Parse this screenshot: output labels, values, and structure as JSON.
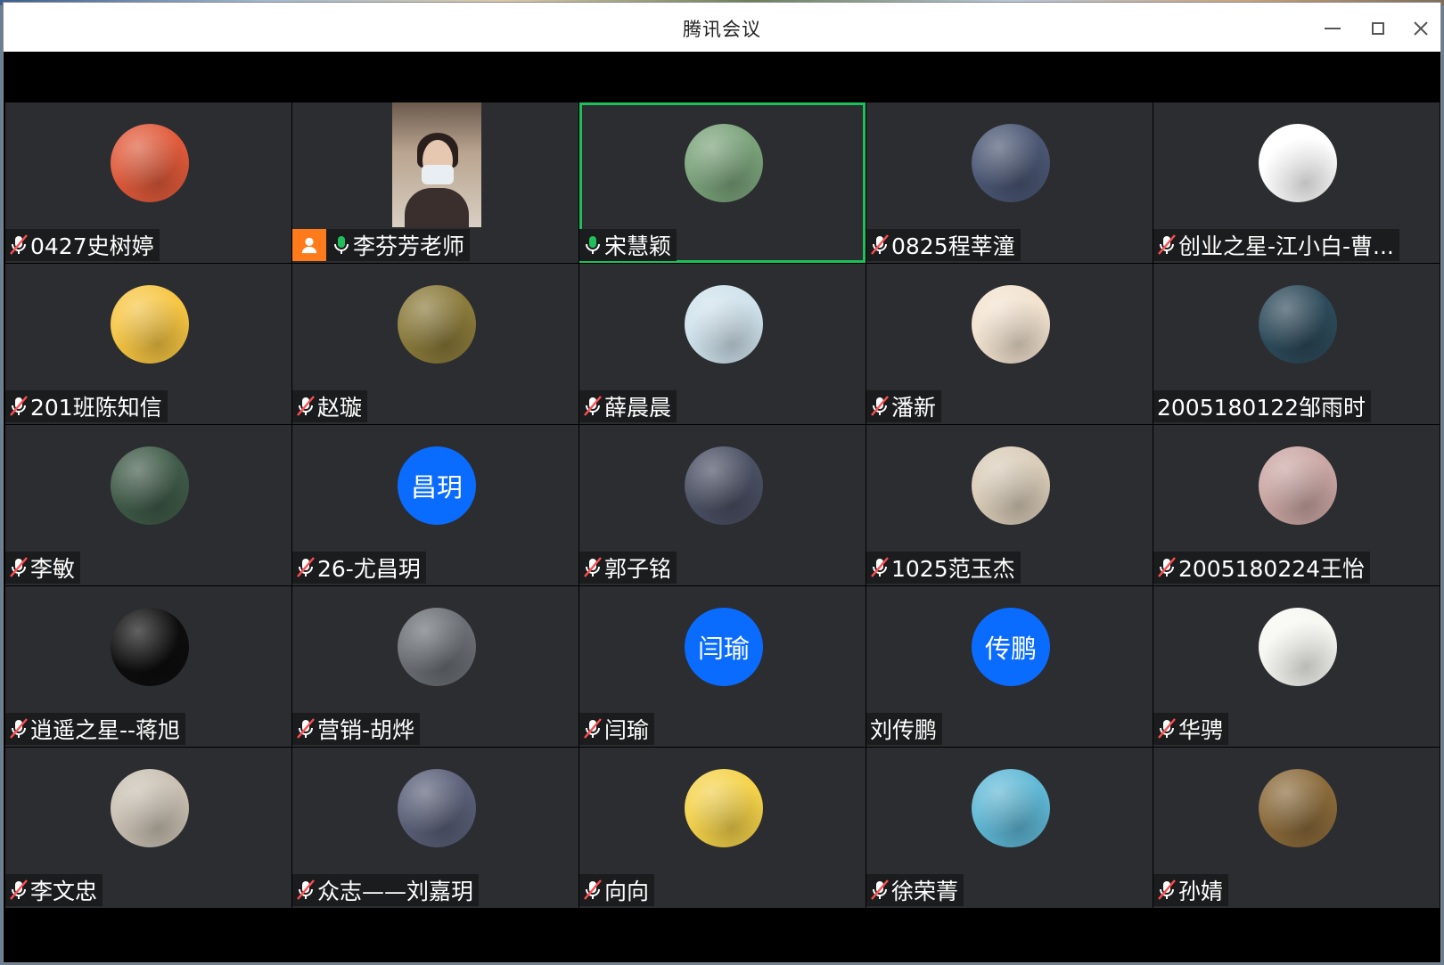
{
  "window": {
    "title": "腾讯会议"
  },
  "participants": [
    {
      "name": "0427史树婷",
      "mic": "muted",
      "avatar": {
        "kind": "image",
        "bg": "#e05a3a",
        "icon": "sunflower-avatar"
      }
    },
    {
      "name": "李芬芳老师",
      "mic": "active",
      "video": true,
      "host": true
    },
    {
      "name": "宋慧颖",
      "mic": "active",
      "speaking": true,
      "avatar": {
        "kind": "image",
        "bg": "#7aa27a",
        "icon": "cartoon-girl-avatar"
      }
    },
    {
      "name": "0825程莘潼",
      "mic": "muted",
      "avatar": {
        "kind": "image",
        "bg": "#4a5673",
        "icon": "portrait-avatar"
      }
    },
    {
      "name": "创业之星-江小白-曹...",
      "mic": "muted",
      "avatar": {
        "kind": "image",
        "bg": "#ffffff",
        "icon": "cartoon-boy-avatar"
      }
    },
    {
      "name": "201班陈知信",
      "mic": "muted",
      "avatar": {
        "kind": "image",
        "bg": "#f6c542",
        "icon": "anime-fox-avatar"
      }
    },
    {
      "name": "赵璇",
      "mic": "muted",
      "avatar": {
        "kind": "image",
        "bg": "#8a7a3a",
        "icon": "painting-avatar"
      }
    },
    {
      "name": "薛晨晨",
      "mic": "muted",
      "avatar": {
        "kind": "image",
        "bg": "#cfe2ec",
        "icon": "umbrella-avatar"
      }
    },
    {
      "name": "潘新",
      "mic": "muted",
      "avatar": {
        "kind": "image",
        "bg": "#f2e2cf",
        "icon": "cartoon-hug-avatar"
      }
    },
    {
      "name": "2005180122邹雨时",
      "mic": "none",
      "avatar": {
        "kind": "image",
        "bg": "#2d4a5a",
        "icon": "seaside-portrait-avatar"
      }
    },
    {
      "name": "李敏",
      "mic": "muted",
      "avatar": {
        "kind": "image",
        "bg": "#3f5a48",
        "icon": "nature-portrait-avatar"
      }
    },
    {
      "name": "26-尤昌玥",
      "mic": "muted",
      "avatar": {
        "kind": "initials",
        "text": "昌玥",
        "bg": "#0a6cff"
      }
    },
    {
      "name": "郭子铭",
      "mic": "muted",
      "avatar": {
        "kind": "image",
        "bg": "#4a4f63",
        "icon": "anime-man-avatar"
      }
    },
    {
      "name": "1025范玉杰",
      "mic": "muted",
      "avatar": {
        "kind": "image",
        "bg": "#d9ccb8",
        "icon": "girl-portrait-avatar"
      }
    },
    {
      "name": "2005180224王怡",
      "mic": "muted",
      "avatar": {
        "kind": "image",
        "bg": "#caa6a3",
        "icon": "illustration-avatar"
      }
    },
    {
      "name": "逍遥之星--蒋旭",
      "mic": "muted",
      "avatar": {
        "kind": "image",
        "bg": "#0d0d0d",
        "icon": "statue-avatar"
      }
    },
    {
      "name": "营销-胡烨",
      "mic": "muted",
      "avatar": {
        "kind": "image",
        "bg": "#6a6e74",
        "icon": "cap-man-avatar"
      }
    },
    {
      "name": "闫瑜",
      "mic": "muted",
      "avatar": {
        "kind": "initials",
        "text": "闫瑜",
        "bg": "#0a6cff"
      }
    },
    {
      "name": "刘传鹏",
      "mic": "none",
      "avatar": {
        "kind": "initials",
        "text": "传鹏",
        "bg": "#0a6cff"
      }
    },
    {
      "name": "华骋",
      "mic": "muted",
      "avatar": {
        "kind": "image",
        "bg": "#f7f7f2",
        "icon": "sketch-avatar"
      }
    },
    {
      "name": "李文忠",
      "mic": "muted",
      "avatar": {
        "kind": "image",
        "bg": "#c9c0b2",
        "icon": "bird-avatar"
      }
    },
    {
      "name": "众志——刘嘉玥",
      "mic": "muted",
      "avatar": {
        "kind": "image",
        "bg": "#5a5f78",
        "icon": "anime-dark-avatar"
      }
    },
    {
      "name": "向向",
      "mic": "muted",
      "avatar": {
        "kind": "image",
        "bg": "#f4d24a",
        "icon": "tiger-avatar"
      }
    },
    {
      "name": "徐荣菁",
      "mic": "muted",
      "avatar": {
        "kind": "image",
        "bg": "#5fb8d6",
        "icon": "bunny-avatar"
      }
    },
    {
      "name": "孙婧",
      "mic": "muted",
      "avatar": {
        "kind": "image",
        "bg": "#8a6a3a",
        "icon": "costume-portrait-avatar"
      }
    }
  ]
}
